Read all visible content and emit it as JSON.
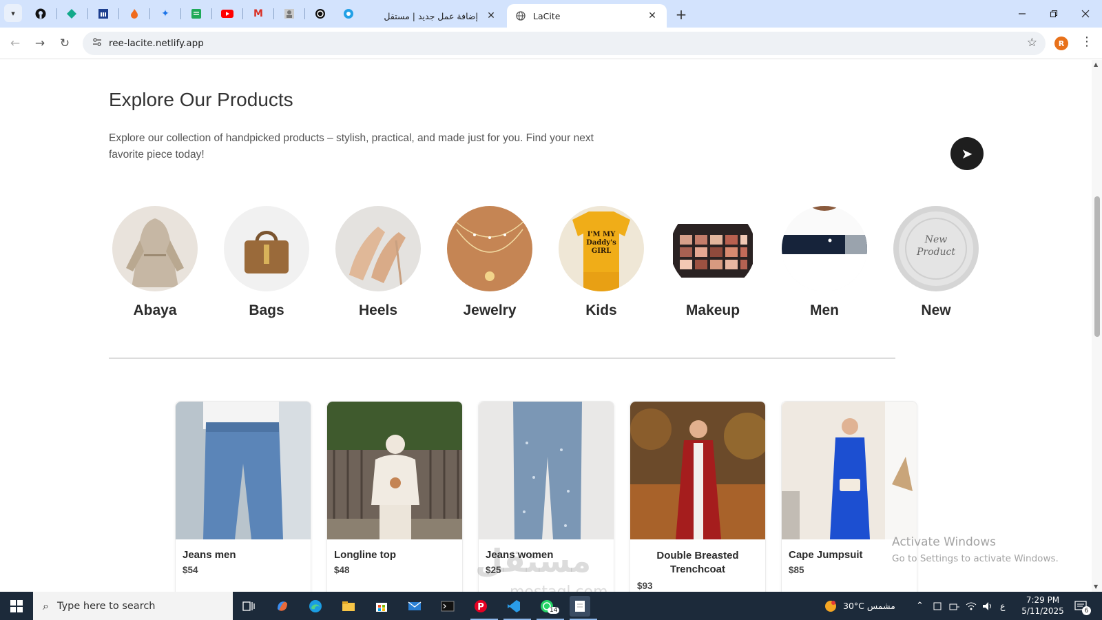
{
  "browser": {
    "tabs": [
      {
        "title": "إضافة عمل جديد | مستقل",
        "active": false
      },
      {
        "title": "LaCite",
        "active": true
      }
    ],
    "pinned_icons": [
      "github-icon",
      "diamond-icon",
      "bank-icon",
      "fire-icon",
      "sparkle-icon",
      "sheets-icon",
      "youtube-icon",
      "gmail-icon",
      "avatar-icon",
      "openai-icon",
      "circle-app-icon"
    ],
    "url": "ree-lacite.netlify.app",
    "profile_initial": "R",
    "close_glyph": "✕",
    "new_tab_glyph": "+"
  },
  "page": {
    "title": "Explore Our Products",
    "description": "Explore our collection of handpicked products – stylish, practical, and made just for you. Find your next favorite piece today!",
    "categories": [
      {
        "label": "Abaya"
      },
      {
        "label": "Bags"
      },
      {
        "label": "Heels"
      },
      {
        "label": "Jewelry"
      },
      {
        "label": "Kids"
      },
      {
        "label": "Makeup"
      },
      {
        "label": "Men"
      },
      {
        "label": "New"
      }
    ],
    "kids_shirt_text": "I'M MY Daddy's GIRL",
    "new_badge_text": "New Product",
    "products": [
      {
        "name": "Jeans men",
        "price": "$54"
      },
      {
        "name": "Longline top",
        "price": "$48"
      },
      {
        "name": "Jeans women",
        "price": "$25"
      },
      {
        "name": "Double Breasted Trenchcoat",
        "price": "$93"
      },
      {
        "name": "Cape Jumpsuit",
        "price": "$85"
      }
    ]
  },
  "overlay": {
    "activate_title": "Activate Windows",
    "activate_sub": "Go to Settings to activate Windows.",
    "watermark": "مستقل",
    "watermark_sub": "mostaql.com"
  },
  "taskbar": {
    "search_placeholder": "Type here to search",
    "weather": "30°C  مشمس",
    "language": "ع",
    "time": "7:29 PM",
    "date": "5/11/2025",
    "whatsapp_badge": "14",
    "notifications": "6"
  },
  "colors": {
    "tabbar": "#d3e3fd",
    "accent_dark": "#1e1e1e",
    "taskbar": "#1c2a3a"
  }
}
